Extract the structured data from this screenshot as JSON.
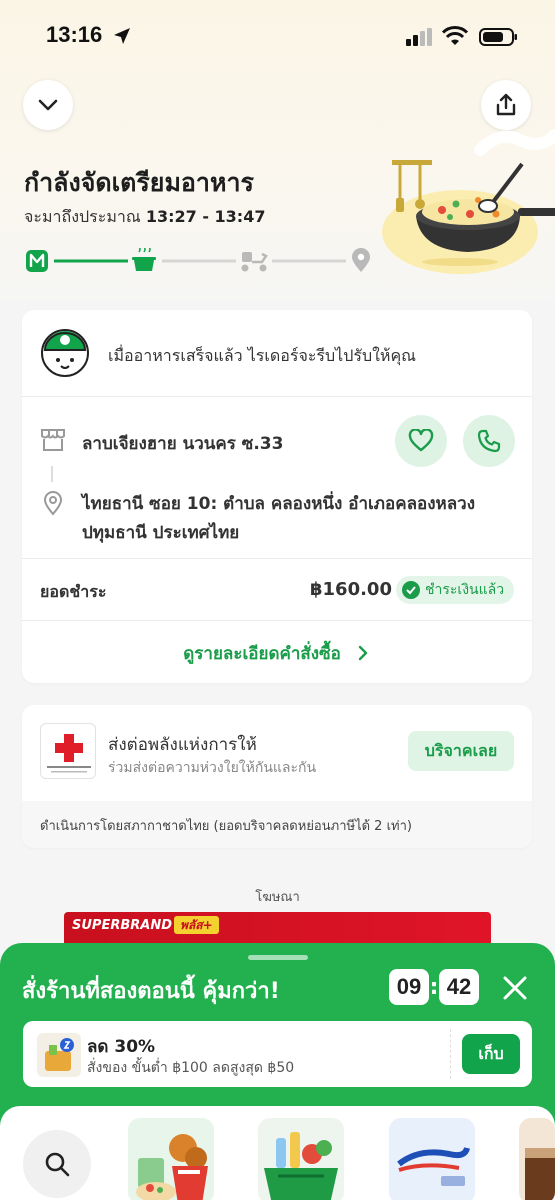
{
  "status_bar": {
    "time": "13:16"
  },
  "header": {
    "title": "กำลังจัดเตรียมอาหาร",
    "eta_prefix": "จะมาถึงประมาณ",
    "eta_time": "13:27 - 13:47",
    "progress_step": 2,
    "progress_steps": [
      "logo",
      "cooking-pot",
      "rider",
      "destination"
    ]
  },
  "order_card": {
    "rider_message": "เมื่ออาหารเสร็จแล้ว ไรเดอร์จะรีบไปรับให้คุณ",
    "store_name": "ลาบเจียงฮาย นวนคร ซ.33",
    "address": "ไทยธานี ซอย 10: ตำบล คลองหนึ่ง อำเภอคลองหลวง ปทุมธานี ประเทศไทย",
    "payment_label": "ยอดชำระ",
    "payment_amount": "฿160.00",
    "payment_status": "ชำระเงินแล้ว",
    "order_details_link": "ดูรายละเอียดคำสั่งซื้อ"
  },
  "donation_card": {
    "title": "ส่งต่อพลังแห่งการให้",
    "subtitle": "ร่วมส่งต่อความห่วงใยให้กันและกัน",
    "button": "บริจาคเลย",
    "logo_text": "สภากาชาดไทย",
    "footer": "ดำเนินการโดยสภากาชาดไทย (ยอดบริจาคลดหย่อนภาษีได้ 2 เท่า)"
  },
  "ad": {
    "label": "โฆษณา",
    "banner_text": "SUPERBRAND",
    "banner_badge": "พลัส+"
  },
  "promo_sheet": {
    "title": "สั่งร้านที่สองตอนนี้ คุ้มกว่า!",
    "timer_minutes": "09",
    "timer_seconds": "42",
    "coupon_title": "ลด 30%",
    "coupon_subtitle": "สั่งของ ขั้นต่ำ ฿100 ลดสูงสุด ฿50",
    "coupon_button": "เก็บ"
  },
  "colors": {
    "brand_green": "#23b04e",
    "accent_green": "#1a9c4a"
  }
}
